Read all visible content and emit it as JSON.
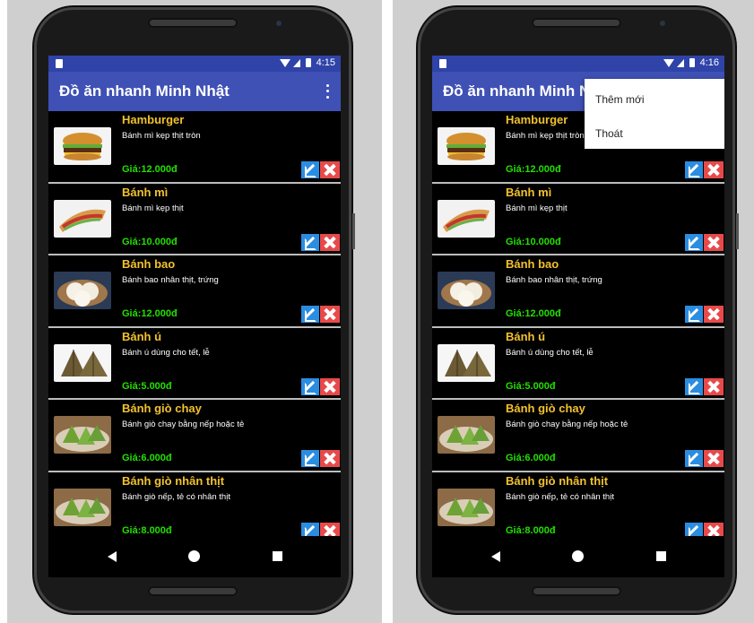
{
  "screens": [
    {
      "status": {
        "time": "4:15"
      },
      "app_title": "Đồ ăn nhanh Minh Nhật",
      "menu_open": false,
      "items": [
        {
          "name": "Hamburger",
          "desc": "Bánh mì kẹp thịt tròn",
          "price": "Giá:12.000đ",
          "image": "hamburger-image"
        },
        {
          "name": "Bánh mì",
          "desc": "Bánh mì kẹp thịt",
          "price": "Giá:10.000đ",
          "image": "banh-mi-image"
        },
        {
          "name": "Bánh bao",
          "desc": "Bánh bao nhân thịt, trứng",
          "price": "Giá:12.000đ",
          "image": "banh-bao-image"
        },
        {
          "name": "Bánh ú",
          "desc": "Bánh ú dùng cho tết, lễ",
          "price": "Giá:5.000đ",
          "image": "banh-u-image"
        },
        {
          "name": "Bánh giò chay",
          "desc": "Bánh giò chay bằng nếp hoặc tẻ",
          "price": "Giá:6.000đ",
          "image": "banh-gio-image"
        },
        {
          "name": "Bánh giò nhân thịt",
          "desc": "Bánh giò nếp, tẻ có nhân thịt",
          "price": "Giá:8.000đ",
          "image": "banh-gio-image"
        }
      ]
    },
    {
      "status": {
        "time": "4:16"
      },
      "app_title": "Đồ ăn nhanh Minh Nhật",
      "menu_open": true,
      "menu": [
        "Thêm mới",
        "Thoát"
      ],
      "items": [
        {
          "name": "Hamburger",
          "desc": "Bánh mì kẹp thịt tròn",
          "price": "Giá:12.000đ",
          "image": "hamburger-image"
        },
        {
          "name": "Bánh mì",
          "desc": "Bánh mì kẹp thịt",
          "price": "Giá:10.000đ",
          "image": "banh-mi-image"
        },
        {
          "name": "Bánh bao",
          "desc": "Bánh bao nhân thịt, trứng",
          "price": "Giá:12.000đ",
          "image": "banh-bao-image"
        },
        {
          "name": "Bánh ú",
          "desc": "Bánh ú dùng cho tết, lễ",
          "price": "Giá:5.000đ",
          "image": "banh-u-image"
        },
        {
          "name": "Bánh giò chay",
          "desc": "Bánh giò chay bằng nếp hoặc tẻ",
          "price": "Giá:6.000đ",
          "image": "banh-gio-image"
        },
        {
          "name": "Bánh giò nhân thịt",
          "desc": "Bánh giò nếp, tẻ có nhân thịt",
          "price": "Giá:8.000đ",
          "image": "banh-gio-image"
        }
      ]
    }
  ],
  "colors": {
    "appbar": "#3f51b5",
    "statusbar": "#2f43a8",
    "name": "#f2c12e",
    "price": "#22e000",
    "edit": "#2b8de0",
    "delete": "#e84a4a"
  }
}
